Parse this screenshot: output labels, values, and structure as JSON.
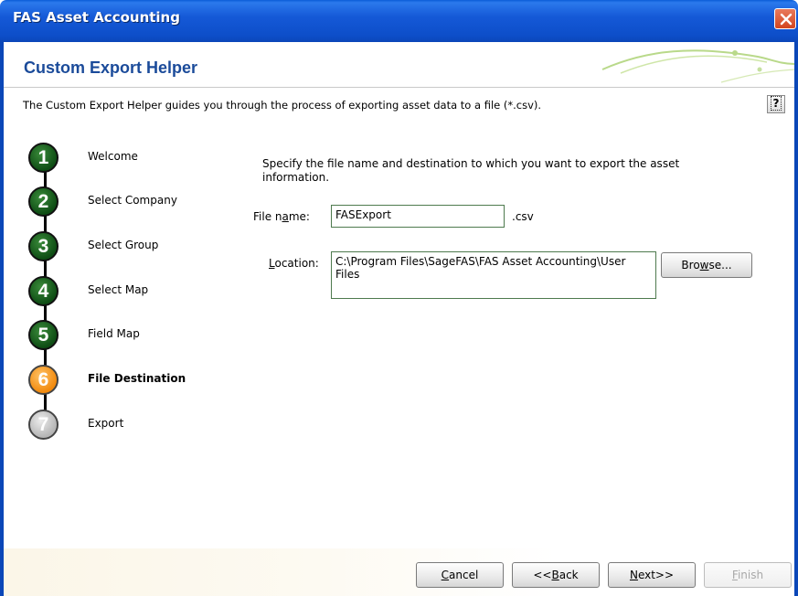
{
  "window": {
    "title": "FAS Asset Accounting"
  },
  "header": {
    "title": "Custom Export Helper",
    "intro": "The Custom Export Helper guides you through the process of exporting asset data to a file (*.csv).",
    "help_label": "?"
  },
  "steps": [
    {
      "number": "1",
      "label": "Welcome",
      "state": "done"
    },
    {
      "number": "2",
      "label": "Select Company",
      "state": "done"
    },
    {
      "number": "3",
      "label": "Select Group",
      "state": "done"
    },
    {
      "number": "4",
      "label": "Select Map",
      "state": "done"
    },
    {
      "number": "5",
      "label": "Field Map",
      "state": "done"
    },
    {
      "number": "6",
      "label": "File Destination",
      "state": "current"
    },
    {
      "number": "7",
      "label": "Export",
      "state": "pending"
    }
  ],
  "main": {
    "instruction": "Specify the file name and destination to which you want to export the asset information.",
    "file_name_label_pre": "File n",
    "file_name_label_u": "a",
    "file_name_label_post": "me:",
    "file_name_value": "FASExport",
    "extension": ".csv",
    "location_label_pre": "",
    "location_label_u": "L",
    "location_label_post": "ocation:",
    "location_value": "C:\\Program Files\\SageFAS\\FAS Asset Accounting\\User Files",
    "browse_pre": "Bro",
    "browse_u": "w",
    "browse_post": "se..."
  },
  "footer": {
    "cancel_u": "C",
    "cancel_post": "ancel",
    "back_pre": "<<",
    "back_u": "B",
    "back_post": "ack",
    "next_u": "N",
    "next_post": "ext>>",
    "finish_u": "F",
    "finish_post": "inish"
  },
  "colors": {
    "title_bar": "#0d4ec9",
    "header_title": "#1b4b9a",
    "step_done": "#0e4d14",
    "step_current": "#f28a0d",
    "step_pending": "#b5b5b5",
    "close_button": "#d2451f"
  },
  "icons": {
    "close": "close-icon",
    "help": "help-icon"
  }
}
